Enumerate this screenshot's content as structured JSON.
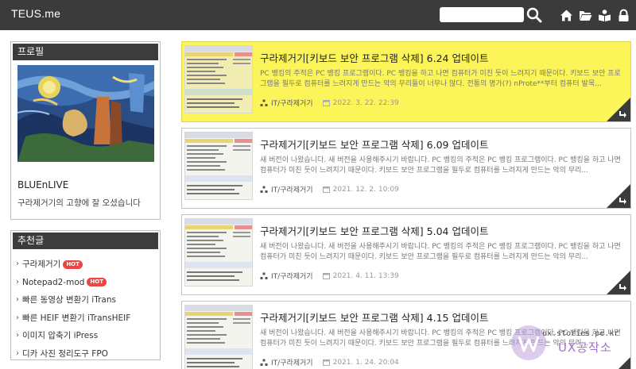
{
  "header": {
    "logo": "TEUS.me",
    "search": {
      "placeholder": "",
      "value": ""
    },
    "icons": [
      "search-icon",
      "home-icon",
      "folder-icon",
      "book-icon",
      "lock-icon"
    ],
    "bg_color": "#3b3b3b"
  },
  "sidebar": {
    "profile": {
      "title": "프로필",
      "name": "BLUEnLIVE",
      "description": "구라제거기의 고향에 잘 오셨습니다"
    },
    "recommended": {
      "title": "추천글",
      "items": [
        {
          "label": "구라제거기",
          "badge": "HOT"
        },
        {
          "label": "Notepad2-mod",
          "badge": "HOT"
        },
        {
          "label": "빠른 동영상 변환기 iTrans",
          "badge": ""
        },
        {
          "label": "빠른 HEIF 변환기 iTransHEIF",
          "badge": ""
        },
        {
          "label": "이미지 압축기 iPress",
          "badge": ""
        },
        {
          "label": "디카 사진 정리도구 FPO",
          "badge": ""
        }
      ]
    }
  },
  "posts": [
    {
      "title": "구라제거기[키보드 보안 프로그램 삭제] 6.24 업데이트",
      "excerpt": "PC 뱅킹의 주적은 PC 뱅킹 프로그램이다. PC 뱅킹을 하고 나면 컴퓨터가 미친 듯이 느려지기 때문이다. 키보드 보안 프로그램을 필두로 컴퓨터를 느려지게 만드는 악의 무리들이 너무나 많다. 전통의 명가(?) nProte**부터 컴퓨터 발목...",
      "category": "IT/구라제거기",
      "date": "2022. 3. 22. 22:39",
      "highlighted": true
    },
    {
      "title": "구라제거기[키보드 보안 프로그램 삭제] 6.09 업데이트",
      "excerpt": "새 버전이 나왔습니다. 새 버전을 사용해주시기 바랍니다. PC 뱅킹의 주적은 PC 뱅킹 프로그램이다. PC 뱅킹을 하고 나면 컴퓨터가 미친 듯이 느려지기 때문이다. 키보드 보안 프로그램을 필두로 컴퓨터를 느려지게 만드는 악의 무리...",
      "category": "IT/구라제거기",
      "date": "2021. 12. 2. 10:09",
      "highlighted": false
    },
    {
      "title": "구라제거기[키보드 보안 프로그램 삭제] 5.04 업데이트",
      "excerpt": "새 버전이 나왔습니다. 새 버전을 사용해주시기 바랍니다. PC 뱅킹의 주적은 PC 뱅킹 프로그램이다. PC 뱅킹을 하고 나면 컴퓨터가 미친 듯이 느려지기 때문이다. 키보드 보안 프로그램을 필두로 컴퓨터를 느려지게 만드는 악의 무리...",
      "category": "IT/구라제거기",
      "date": "2021. 4. 11. 13:39",
      "highlighted": false
    },
    {
      "title": "구라제거기[키보드 보안 프로그램 삭제] 4.15 업데이트",
      "excerpt": "새 버전이 나왔습니다. 새 버전을 사용해주시기 바랍니다. PC 뱅킹의 주적은 PC 뱅킹 프로그램이다. PC 뱅킹을 하고 나면 컴퓨터가 미친 듯이 느려지기 때문이다. 키보드 보안 프로그램을 필두로 컴퓨터를 느려지게 만드는 악의 무리...",
      "category": "IT/구라제거기",
      "date": "2021. 1. 24. 20:04",
      "highlighted": false
    }
  ],
  "watermark": {
    "url": "ux.stories.pe.kr",
    "name": "UX공작소"
  },
  "colors": {
    "highlight": "#fcf55a",
    "hot_badge": "#ee4444",
    "dark": "#3b3b3b"
  }
}
